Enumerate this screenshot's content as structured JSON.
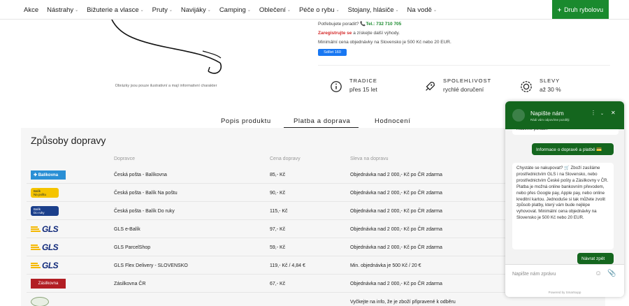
{
  "nav": {
    "items": [
      {
        "label": "Akce",
        "has_menu": false
      },
      {
        "label": "Nástrahy",
        "has_menu": true
      },
      {
        "label": "Bižuterie a vlasce",
        "has_menu": true
      },
      {
        "label": "Pruty",
        "has_menu": true
      },
      {
        "label": "Navijáky",
        "has_menu": true
      },
      {
        "label": "Camping",
        "has_menu": true
      },
      {
        "label": "Oblečení",
        "has_menu": true
      },
      {
        "label": "Péče o rybu",
        "has_menu": true
      },
      {
        "label": "Stojany, hlásiče",
        "has_menu": true
      },
      {
        "label": "Na vodě",
        "has_menu": true
      }
    ],
    "cta_label": "Druh rybolovu"
  },
  "product": {
    "image_caption": "Obrázky jsou pouze ilustrativní a mají informativní charakter"
  },
  "info": {
    "advice_text": "Potřebujete poradit?",
    "phone": "Tel.: 732 710 705",
    "register_link": "Zaregistrujte se",
    "register_rest": "a získejte další výhody.",
    "min_order": "Minimální cena objednávky na Slovensko je 500 Kč nebo 20 EUR.",
    "share_label": "Sdílet 160"
  },
  "features": [
    {
      "title": "TRADICE",
      "subtitle": "přes 15 let",
      "icon": "info-icon"
    },
    {
      "title": "SPOLEHLIVOST",
      "subtitle": "rychlé doručení",
      "icon": "rocket-icon"
    },
    {
      "title": "SLEVY",
      "subtitle": "až 30 %",
      "icon": "percent-badge-icon"
    }
  ],
  "tabs": [
    {
      "label": "Popis produktu",
      "active": false
    },
    {
      "label": "Platba a doprava",
      "active": true
    },
    {
      "label": "Hodnocení",
      "active": false
    }
  ],
  "shipping": {
    "title": "Způsoby dopravy",
    "headers": [
      "Dopravce",
      "Cena dopravy",
      "Sleva na dopravu"
    ],
    "rows": [
      {
        "logo": "Balíkovna",
        "carrier": "Česká pošta - Balíkovna",
        "price": "85,- Kč",
        "discount": "Objednávka nad 2 000,- Kč po ČR zdarma"
      },
      {
        "logo": "Balík Na poštu",
        "carrier": "Česká pošta - Balík Na poštu",
        "price": "90,- Kč",
        "discount": "Objednávka nad 2 000,- Kč po ČR zdarma"
      },
      {
        "logo": "Balík Do ruky",
        "carrier": "Česká pošta - Balík Do ruky",
        "price": "115,- Kč",
        "discount": "Objednávka nad 2 000,- Kč po ČR zdarma"
      },
      {
        "logo": "GLS",
        "carrier": "GLS e-Balík",
        "price": "97,- Kč",
        "discount": "Objednávka nad 2 000,- Kč po ČR zdarma"
      },
      {
        "logo": "GLS",
        "carrier": "GLS ParcelShop",
        "price": "59,- Kč",
        "discount": "Objednávka nad 2 000,- Kč po ČR zdarma"
      },
      {
        "logo": "GLS",
        "carrier": "GLS Flex Delivery - SLOVENSKO",
        "price": "119,- Kč / 4,84 €",
        "discount": "Min. objednávka je 500 Kč / 20 €"
      },
      {
        "logo": "Zásilkovna",
        "carrier": "Zásilkovna ČR",
        "price": "67,- Kč",
        "discount": "Objednávka nad 2 000,- Kč po ČR zdarma"
      },
      {
        "logo": "",
        "carrier": "",
        "price": "",
        "discount": "Vyčkejte na info, že je zboží připravené k odběru"
      }
    ]
  },
  "chat": {
    "title": "Napište nám",
    "subtitle": "Rádi vám odpovíme později",
    "prev_snippet": "můžeme poradit?",
    "user_msg_1": "Informace o dopravě a platbě 💳",
    "bot_msg": "Chystáte se nakupovat? 🛒 Zboží zasíláme prostřednictvím GLS i na Slovensko, nebo prostřednictvím České pošty a Zásilkovny v ČR. Platba je možná online bankovním převodem, nebo přes Google pay, Apple pay, nebo online kreditní kartou. Jednoduše si tak můžete zvolit způsob platby, který vám bude nejlépe vyhovovat. Minimální cena objednávky na Slovensko je 500 Kč nebo 20 EUR.",
    "user_msg_2": "Návrat zpět",
    "input_placeholder": "Napište nám zprávu",
    "footer": "Powered by Smartsupp"
  },
  "colors": {
    "brand_green": "#1a8a2e",
    "chat_green": "#14661e",
    "register_red": "#d42a2a",
    "facebook_blue": "#1877f2"
  }
}
